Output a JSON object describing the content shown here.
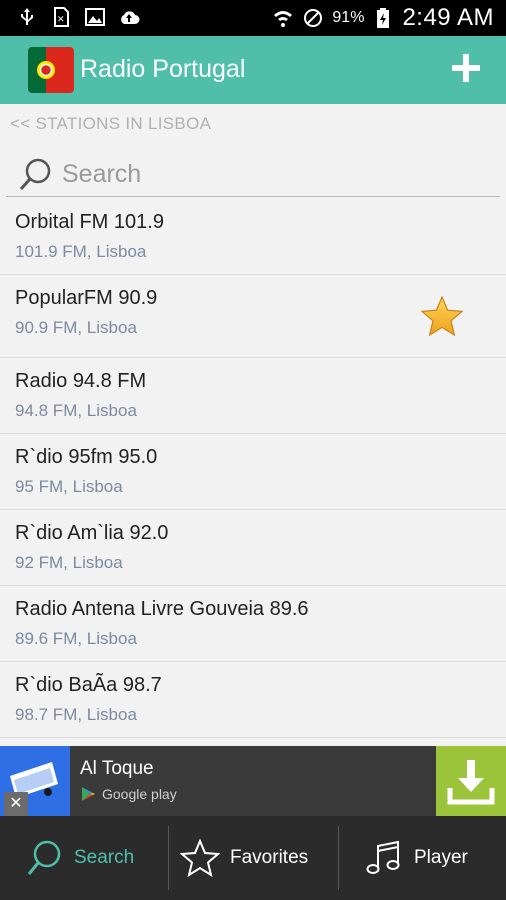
{
  "status_bar": {
    "battery_percent": "91%",
    "time": "2:49 AM"
  },
  "app_bar": {
    "title": "Radio Portugal",
    "add_label": "+",
    "accent_color": "#4fbfaa"
  },
  "breadcrumb": "<< STATIONS IN LISBOA",
  "search": {
    "placeholder": "Search",
    "value": ""
  },
  "stations": [
    {
      "name": "Orbital FM 101.9",
      "detail": "101.9 FM, Lisboa",
      "favorite": false
    },
    {
      "name": "PopularFM 90.9",
      "detail": "90.9 FM, Lisboa",
      "favorite": true
    },
    {
      "name": "Radio 94.8 FM",
      "detail": "94.8 FM, Lisboa",
      "favorite": false
    },
    {
      "name": "R`dio 95fm 95.0",
      "detail": "95 FM, Lisboa",
      "favorite": false
    },
    {
      "name": "R`dio Am`lia 92.0",
      "detail": "92 FM, Lisboa",
      "favorite": false
    },
    {
      "name": "Radio Antena Livre Gouveia 89.6",
      "detail": "89.6 FM, Lisboa",
      "favorite": false
    },
    {
      "name": "R`dio BaÃa 98.7",
      "detail": "98.7 FM, Lisboa",
      "favorite": false
    }
  ],
  "ad": {
    "app_name": "Al Toque",
    "store_label": "Google play",
    "close_label": "✕"
  },
  "bottom_nav": {
    "search_label": "Search",
    "favorites_label": "Favorites",
    "player_label": "Player"
  }
}
